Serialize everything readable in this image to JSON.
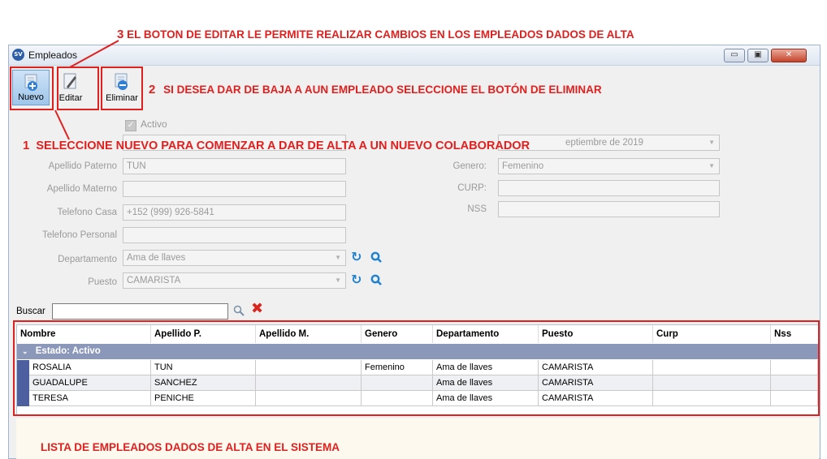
{
  "annotations": {
    "a3": {
      "num": "3",
      "text": "EL BOTON DE EDITAR LE PERMITE REALIZAR CAMBIOS EN LOS EMPLEADOS DADOS DE ALTA"
    },
    "a2": {
      "num": "2",
      "text": "SI DESEA DAR DE BAJA A AUN EMPLEADO SELECCIONE EL BOTÓN DE ELIMINAR"
    },
    "a1": {
      "num": "1",
      "text": "SELECCIONE NUEVO PARA COMENZAR A DAR DE ALTA A UN NUEVO COLABORADOR"
    },
    "bottom": "LISTA DE EMPLEADOS DADOS DE ALTA EN EL SISTEMA"
  },
  "window": {
    "app_badge": "SV",
    "title": "Empleados",
    "min": "▭",
    "max": "▣",
    "close": "✕"
  },
  "toolbar": {
    "nuevo": "Nuevo",
    "editar": "Editar",
    "eliminar": "Eliminar"
  },
  "form": {
    "activo_label": "Activo",
    "apellido_paterno_label": "Apellido Paterno",
    "apellido_paterno_value": "TUN",
    "apellido_materno_label": "Apellido Materno",
    "apellido_materno_value": "",
    "telefono_casa_label": "Telefono Casa",
    "telefono_casa_value": "+152 (999) 926-5841",
    "telefono_personal_label": "Telefono Personal",
    "telefono_personal_value": "",
    "departamento_label": "Departamento",
    "departamento_value": "Ama de llaves",
    "puesto_label": "Puesto",
    "puesto_value": "CAMARISTA",
    "fecha_value_partial": "eptiembre de 2019",
    "genero_label": "Genero:",
    "genero_value": "Femenino",
    "curp_label": "CURP:",
    "curp_value": "",
    "nss_label": "NSS",
    "nss_value": ""
  },
  "search": {
    "label": "Buscar",
    "value": ""
  },
  "grid": {
    "columns": [
      "Nombre",
      "Apellido P.",
      "Apellido M.",
      "Genero",
      "Departamento",
      "Puesto",
      "Curp",
      "Nss"
    ],
    "group_label": "Estado: Activo",
    "rows": [
      [
        "ROSALIA",
        "TUN",
        "",
        "Femenino",
        "Ama de llaves",
        "CAMARISTA",
        "",
        ""
      ],
      [
        "GUADALUPE",
        "SANCHEZ",
        "",
        "",
        "Ama de llaves",
        "CAMARISTA",
        "",
        ""
      ],
      [
        "TERESA",
        "PENICHE",
        "",
        "",
        "Ama de llaves",
        "CAMARISTA",
        "",
        ""
      ]
    ]
  },
  "colors": {
    "annotation": "#e0201f",
    "group_header": "#8b98ba",
    "row_marker": "#4d5f9e",
    "refresh_icon": "#1e82d0"
  }
}
